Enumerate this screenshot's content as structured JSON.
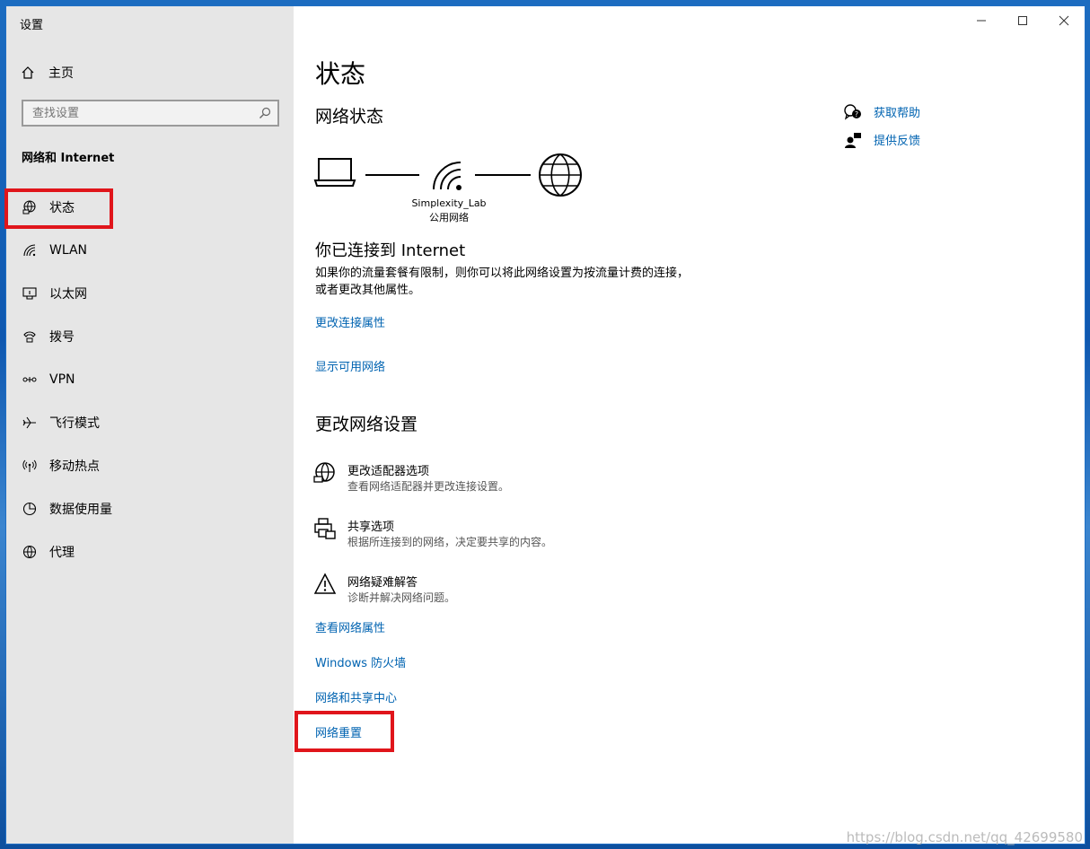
{
  "window": {
    "title": "设置"
  },
  "sidebar": {
    "home_label": "主页",
    "search_placeholder": "查找设置",
    "section_title": "网络和 Internet",
    "items": [
      {
        "label": "状态",
        "icon": "status-globe-icon"
      },
      {
        "label": "WLAN",
        "icon": "wifi-icon"
      },
      {
        "label": "以太网",
        "icon": "ethernet-icon"
      },
      {
        "label": "拨号",
        "icon": "dialup-icon"
      },
      {
        "label": "VPN",
        "icon": "vpn-icon"
      },
      {
        "label": "飞行模式",
        "icon": "airplane-icon"
      },
      {
        "label": "移动热点",
        "icon": "hotspot-icon"
      },
      {
        "label": "数据使用量",
        "icon": "data-usage-icon"
      },
      {
        "label": "代理",
        "icon": "proxy-globe-icon"
      }
    ]
  },
  "main": {
    "title": "状态",
    "network_status_heading": "网络状态",
    "network_name": "Simplexity_Lab",
    "network_type": "公用网络",
    "connected_heading": "你已连接到 Internet",
    "connected_desc": "如果你的流量套餐有限制，则你可以将此网络设置为按流量计费的连接，或者更改其他属性。",
    "links_top": [
      "更改连接属性",
      "显示可用网络"
    ],
    "change_heading": "更改网络设置",
    "options": [
      {
        "title": "更改适配器选项",
        "desc": "查看网络适配器并更改连接设置。",
        "icon": "adapter-globe-icon"
      },
      {
        "title": "共享选项",
        "desc": "根据所连接到的网络，决定要共享的内容。",
        "icon": "printer-share-icon"
      },
      {
        "title": "网络疑难解答",
        "desc": "诊断并解决网络问题。",
        "icon": "warning-icon"
      }
    ],
    "links_bottom": [
      "查看网络属性",
      "Windows 防火墙",
      "网络和共享中心",
      "网络重置"
    ]
  },
  "help": {
    "get_help": "获取帮助",
    "feedback": "提供反馈"
  },
  "watermark": "https://blog.csdn.net/qq_42699580",
  "colors": {
    "link": "#0063b1",
    "highlight": "#e0151b",
    "sidebar_bg": "#e6e6e6"
  }
}
